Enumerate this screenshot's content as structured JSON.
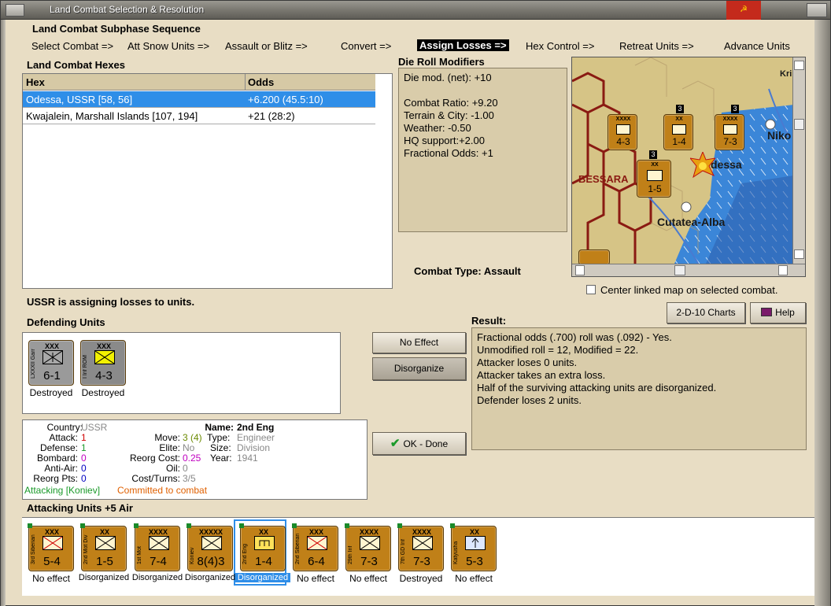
{
  "window": {
    "title": "Land Combat Selection & Resolution"
  },
  "sequence": {
    "title": "Land Combat Subphase Sequence",
    "steps": [
      "Select Combat =>",
      "Att Snow Units =>",
      "Assault or Blitz =>",
      "Convert =>",
      "Assign Losses =>",
      "Hex Control =>",
      "Retreat Units =>",
      "Advance Units"
    ],
    "active_index": 4
  },
  "hexes": {
    "title": "Land Combat Hexes",
    "columns": [
      "Hex",
      "Odds"
    ],
    "rows": [
      {
        "hex": "Odessa, USSR [58, 56]",
        "odds": "+6.200 (45.5:10)",
        "selected": true
      },
      {
        "hex": "Kwajalein, Marshall Islands [107, 194]",
        "odds": "+21 (28:2)",
        "selected": false
      }
    ]
  },
  "modifiers": {
    "title": "Die Roll Modifiers",
    "lines": [
      "Die mod. (net): +10",
      "",
      "Combat Ratio: +9.20",
      "Terrain & City: -1.00",
      "Weather: -0.50",
      "HQ support:+2.00",
      "Fractional Odds: +1"
    ]
  },
  "map": {
    "labels": {
      "odessa": "dessa",
      "bessarabia": "BESSARA",
      "cutatea": "Cutatea-Alba",
      "niko": "Niko",
      "kri": "Kri"
    },
    "counters": [
      {
        "size": "XXXX",
        "str": "4-3"
      },
      {
        "size": "XX",
        "str": "1-4"
      },
      {
        "size": "XXXX",
        "str": "7-3"
      },
      {
        "size": "XX",
        "str": "1-5"
      }
    ],
    "stack_numbers": [
      "3",
      "3",
      "3"
    ]
  },
  "combat_type": {
    "label": "Combat Type:",
    "value": "Assault"
  },
  "center_map": {
    "label": "Center linked map on selected combat."
  },
  "status": "USSR is assigning losses to units.",
  "defending": {
    "title": "Defending Units",
    "units": [
      {
        "size": "XXX",
        "name": "LXXXII Garr",
        "str": "6-1",
        "status": "Destroyed"
      },
      {
        "size": "XXX",
        "name": "I Inf ROM",
        "str": "4-3",
        "status": "Destroyed"
      }
    ]
  },
  "buttons": {
    "no_effect": "No Effect",
    "disorganize": "Disorganize",
    "ok_done": "OK - Done",
    "charts": "2-D-10 Charts",
    "help": "Help"
  },
  "result": {
    "title": "Result:",
    "lines": [
      "Fractional odds (.700) roll was (.092)  - Yes.",
      "Unmodified roll = 12, Modified = 22.",
      "Attacker loses 0 units.",
      "Attacker takes an extra loss.",
      "Half of the surviving attacking units are disorganized.",
      "Defender loses 2 units."
    ]
  },
  "info": {
    "country_label": "Country:",
    "country": "USSR",
    "attack_label": "Attack:",
    "attack": "1",
    "defense_label": "Defense:",
    "defense": "1",
    "bombard_label": "Bombard:",
    "bombard": "0",
    "antiair_label": "Anti-Air:",
    "antiair": "0",
    "reorgpts_label": "Reorg Pts:",
    "reorgpts": "0",
    "name_label": "Name:",
    "name": "2nd Eng",
    "move_label": "Move:",
    "move": "3 (4)",
    "type_label": "Type:",
    "type": "Engineer",
    "elite_label": "Elite:",
    "elite": "No",
    "size_label": "Size:",
    "size": "Division",
    "reorgcost_label": "Reorg Cost:",
    "reorgcost": "0.25",
    "year_label": "Year:",
    "year": "1941",
    "oil_label": "Oil:",
    "oil": "0",
    "costturns_label": "Cost/Turns:",
    "costturns": "3/5",
    "attacking": "Attacking [Koniev]",
    "committed": "Committed to combat"
  },
  "attacking": {
    "title": "Attacking Units +5 Air",
    "units": [
      {
        "size": "XXX",
        "name": "3rd Siberian",
        "str": "5-4",
        "status": "No effect"
      },
      {
        "size": "XX",
        "name": "2nd Mot Div",
        "str": "1-5",
        "status": "Disorganized"
      },
      {
        "size": "XXXX",
        "name": "1st Mot",
        "str": "7-4",
        "status": "Disorganized"
      },
      {
        "size": "XXXXX",
        "name": "Koniev",
        "str": "8(4)3",
        "status": "Disorganized"
      },
      {
        "size": "XX",
        "name": "2nd Eng",
        "str": "1-4",
        "status": "Disorganized"
      },
      {
        "size": "XXX",
        "name": "2nd Siberian",
        "str": "6-4",
        "status": "No effect"
      },
      {
        "size": "XXXX",
        "name": "29th Inf",
        "str": "7-3",
        "status": "No effect"
      },
      {
        "size": "XXXX",
        "name": "7th GD Inf",
        "str": "7-3",
        "status": "Destroyed"
      },
      {
        "size": "XX",
        "name": "Katyusha",
        "str": "5-3",
        "status": "No effect"
      }
    ],
    "selected_index": 4
  },
  "colors": {
    "counter_tan": "#c08018",
    "selection": "#2f8ee8",
    "attack_red": "#d00000",
    "defense_green": "#1a9a2a",
    "bombard_magenta": "#c000c0",
    "antiair_blue": "#0000c0"
  }
}
